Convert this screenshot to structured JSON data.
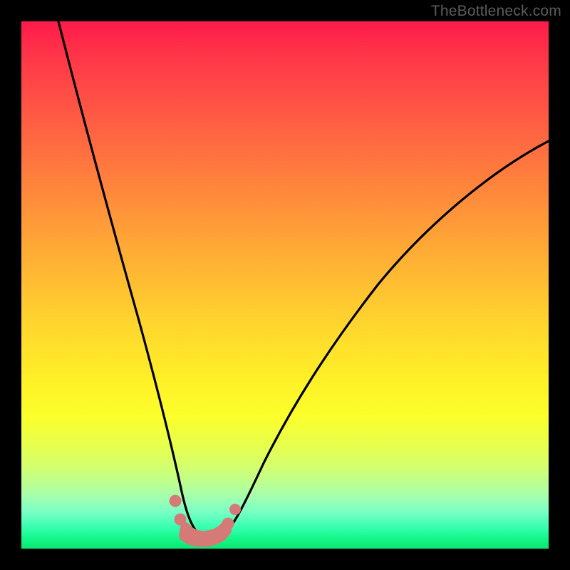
{
  "watermark": {
    "text": "TheBottleneck.com"
  },
  "chart_data": {
    "type": "line",
    "title": "",
    "xlabel": "",
    "ylabel": "",
    "xlim": [
      0,
      100
    ],
    "ylim": [
      0,
      100
    ],
    "gradient_stops": [
      {
        "pos": 0,
        "color": "#ff1a4b"
      },
      {
        "pos": 50,
        "color": "#ffd72d"
      },
      {
        "pos": 80,
        "color": "#e9ff4a"
      },
      {
        "pos": 100,
        "color": "#0de672"
      }
    ],
    "series": [
      {
        "name": "bottleneck-curve",
        "x": [
          7,
          10,
          14,
          18,
          22,
          25,
          27,
          29,
          30,
          32,
          33.5,
          35.5,
          37.5,
          40,
          44,
          50,
          58,
          68,
          80,
          92,
          100
        ],
        "y": [
          100,
          87,
          72,
          56,
          39,
          26,
          17,
          10,
          6,
          3,
          2,
          2,
          3,
          6,
          12,
          21,
          32,
          44,
          56,
          66,
          72
        ]
      }
    ],
    "markers": [
      {
        "x": 29.2,
        "y": 9.0
      },
      {
        "x": 30.2,
        "y": 5.5
      },
      {
        "x": 33.0,
        "y": 2.0
      },
      {
        "x": 36.0,
        "y": 2.0
      },
      {
        "x": 39.2,
        "y": 4.8
      },
      {
        "x": 40.6,
        "y": 7.5
      }
    ],
    "curve_bottom_fill": {
      "x_range": [
        30.8,
        38.5
      ],
      "height_pct": 2.2
    }
  }
}
